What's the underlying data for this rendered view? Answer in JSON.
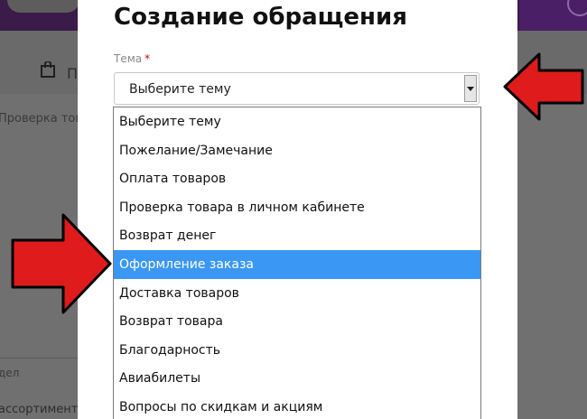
{
  "background": {
    "tab_label": "П",
    "subheading": "Проверка товар",
    "section_label": "дел",
    "assortment_text": "ассортименту"
  },
  "modal": {
    "title": "Создание обращения",
    "field_label": "Тема",
    "required_mark": "*",
    "select": {
      "value": "Выберите тему",
      "options": [
        "Выберите тему",
        "Пожелание/Замечание",
        "Оплата товаров",
        "Проверка товара в личном кабинете",
        "Возврат денег",
        "Оформление заказа",
        "Доставка товаров",
        "Возврат товара",
        "Благодарность",
        "Авиабилеты",
        "Вопросы по скидкам и акциям"
      ],
      "highlighted_index": 5
    }
  },
  "colors": {
    "highlight": "#3a97f3",
    "arrow_fill": "#e01b1b",
    "arrow_outline": "#000000",
    "required": "#d0021b"
  }
}
